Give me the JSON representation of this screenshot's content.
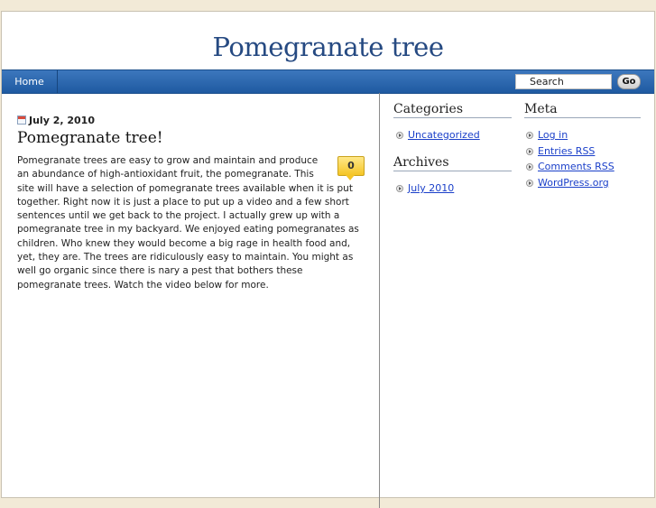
{
  "site": {
    "title": "Pomegranate tree"
  },
  "nav": {
    "home_label": "Home"
  },
  "search": {
    "placeholder": "Search",
    "go_label": "Go"
  },
  "post": {
    "date": "July 2, 2010",
    "title": "Pomegranate tree!",
    "comment_count": "0",
    "body": "Pomegranate trees are easy to grow and maintain and produce an abundance of high-antioxidant fruit, the pomegranate. This site will have a selection of pomegranate trees available when it is put together. Right now it is just a place to put up a video and a few short sentences until we get back to the project. I actually grew up with a pomegranate tree in my backyard. We enjoyed eating pomegranates as children. Who knew they would become a big rage in health food and, yet, they are. The trees are ridiculously easy to maintain. You might as well go organic since there is nary a pest that bothers these pomegranate trees. Watch the video below for more."
  },
  "sidebar": {
    "categories": {
      "title": "Categories",
      "items": [
        "Uncategorized"
      ]
    },
    "archives": {
      "title": "Archives",
      "items": [
        "July 2010"
      ]
    },
    "meta": {
      "title": "Meta",
      "items": [
        "Log in",
        "Entries RSS",
        "Comments RSS",
        "WordPress.org"
      ]
    }
  }
}
